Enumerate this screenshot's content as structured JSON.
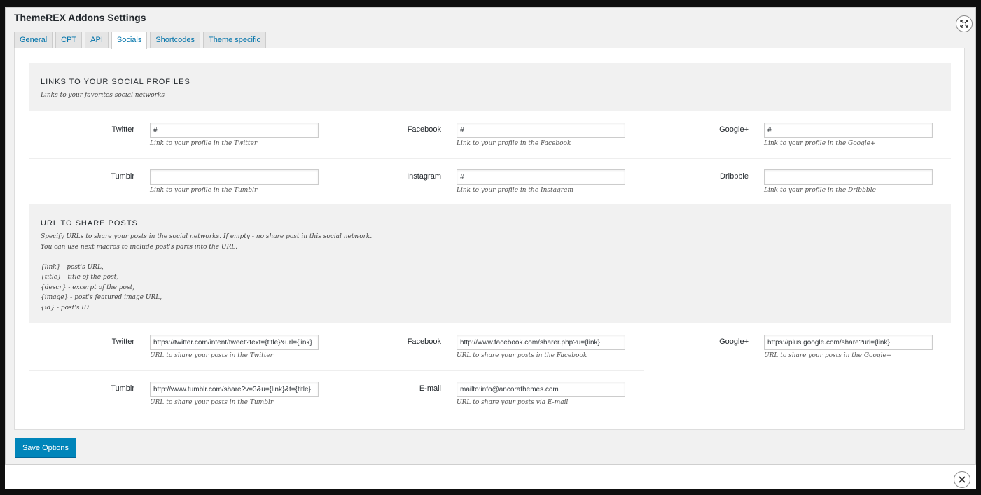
{
  "panel": {
    "title": "ThemeREX Addons Settings"
  },
  "tabs": [
    {
      "label": "General"
    },
    {
      "label": "CPT"
    },
    {
      "label": "API"
    },
    {
      "label": "Socials"
    },
    {
      "label": "Shortcodes"
    },
    {
      "label": "Theme specific"
    }
  ],
  "active_tab": "Socials",
  "links_section": {
    "title": "LINKS TO YOUR SOCIAL PROFILES",
    "desc": "Links to your favorites social networks",
    "fields": [
      {
        "label": "Twitter",
        "value": "#",
        "hint": "Link to your profile in the Twitter"
      },
      {
        "label": "Facebook",
        "value": "#",
        "hint": "Link to your profile in the Facebook"
      },
      {
        "label": "Google+",
        "value": "#",
        "hint": "Link to your profile in the Google+"
      },
      {
        "label": "Tumblr",
        "value": "",
        "hint": "Link to your profile in the Tumblr"
      },
      {
        "label": "Instagram",
        "value": "#",
        "hint": "Link to your profile in the Instagram"
      },
      {
        "label": "Dribbble",
        "value": "",
        "hint": "Link to your profile in the Dribbble"
      }
    ]
  },
  "share_section": {
    "title": "URL TO SHARE POSTS",
    "desc_lines": [
      "Specify URLs to share your posts in the social networks. If empty - no share post in this social network.",
      "You can use next macros to include post's parts into the URL:",
      "",
      "{link} - post's URL,",
      "{title} - title of the post,",
      "{descr} - excerpt of the post,",
      "{image} - post's featured image URL,",
      "{id} - post's ID"
    ],
    "fields": [
      {
        "label": "Twitter",
        "value": "https://twitter.com/intent/tweet?text={title}&url={link}",
        "hint": "URL to share your posts in the Twitter"
      },
      {
        "label": "Facebook",
        "value": "http://www.facebook.com/sharer.php?u={link}",
        "hint": "URL to share your posts in the Facebook"
      },
      {
        "label": "Google+",
        "value": "https://plus.google.com/share?url={link}",
        "hint": "URL to share your posts in the Google+"
      },
      {
        "label": "Tumblr",
        "value": "http://www.tumblr.com/share?v=3&u={link}&t={title}",
        "hint": "URL to share your posts in the Tumblr"
      },
      {
        "label": "E-mail",
        "value": "mailto:info@ancorathemes.com",
        "hint": "URL to share your posts via E-mail"
      }
    ]
  },
  "save_button": {
    "label": "Save Options"
  },
  "colors": {
    "accent": "#0085ba",
    "link": "#0073aa",
    "panel_bg": "#f1f1f1",
    "backdrop": "#0f0f0f"
  },
  "icons": {
    "expand": "expand-icon",
    "close": "close-icon"
  }
}
